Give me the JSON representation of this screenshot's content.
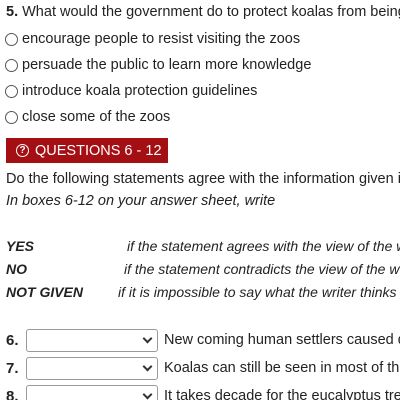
{
  "q5": {
    "number": "5.",
    "question": "What would the government do to protect koalas from being e",
    "options": [
      "encourage people to resist visiting the zoos",
      "persuade the public to learn more knowledge",
      "introduce koala protection guidelines",
      "close some of the zoos"
    ]
  },
  "section": {
    "icon": "?",
    "label": "QUESTIONS 6 - 12",
    "color": "#a40f14"
  },
  "instructions": {
    "line1": "Do the following statements agree with the information given in",
    "line2": "In boxes 6-12 on your answer sheet, write"
  },
  "key": [
    {
      "label": "YES",
      "desc": "if the statement agrees with the view of the w"
    },
    {
      "label": "NO",
      "desc": "if the statement contradicts the view of the w"
    },
    {
      "label": "NOT GIVEN",
      "desc": "if it is impossible to say what the writer thinks"
    }
  ],
  "answers": [
    {
      "number": "6.",
      "value": "",
      "text": "New coming human settlers caused da"
    },
    {
      "number": "7.",
      "value": "",
      "text": "Koalas can still be seen in most of the"
    },
    {
      "number": "8.",
      "value": "",
      "text": "It takes decade for the eucalyptus tree"
    }
  ]
}
